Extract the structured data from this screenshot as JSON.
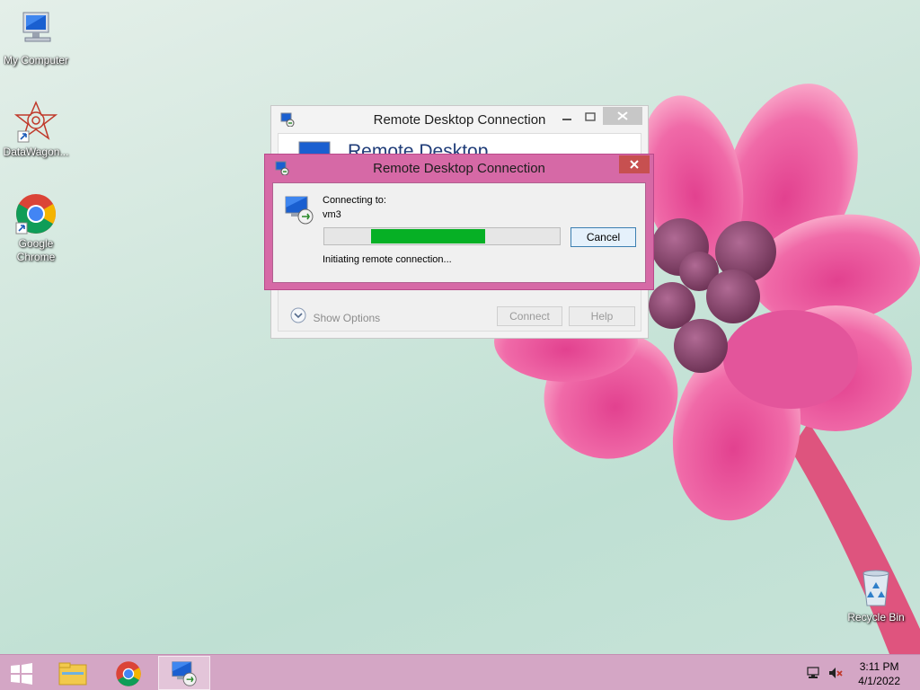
{
  "desktop": {
    "icons": [
      {
        "label": "My Computer",
        "icon": "computer-icon"
      },
      {
        "label": "DataWagon...",
        "icon": "datawagon-icon"
      },
      {
        "label": "Google Chrome",
        "icon": "chrome-icon"
      },
      {
        "label": "Recycle Bin",
        "icon": "recycle-bin-icon"
      }
    ]
  },
  "background_window": {
    "title": "Remote Desktop Connection",
    "banner_text": "Remote Desktop",
    "show_options_label": "Show Options",
    "connect_label": "Connect",
    "help_label": "Help"
  },
  "connecting_dialog": {
    "title": "Remote Desktop Connection",
    "connecting_to_label": "Connecting to:",
    "host": "vm3",
    "status_text": "Initiating remote connection...",
    "cancel_label": "Cancel",
    "progress_fraction": 0.5,
    "progress_color": "#06b025"
  },
  "taskbar": {
    "items": [
      {
        "icon": "windows-start-icon"
      },
      {
        "icon": "file-explorer-icon"
      },
      {
        "icon": "chrome-icon"
      },
      {
        "icon": "remote-desktop-icon",
        "active": true
      }
    ],
    "clock": {
      "time": "3:11 PM",
      "date": "4/1/2022"
    }
  },
  "colors": {
    "active_title_bar": "#d669a6",
    "taskbar": "#d4a6c5",
    "close_button": "#c75050"
  }
}
